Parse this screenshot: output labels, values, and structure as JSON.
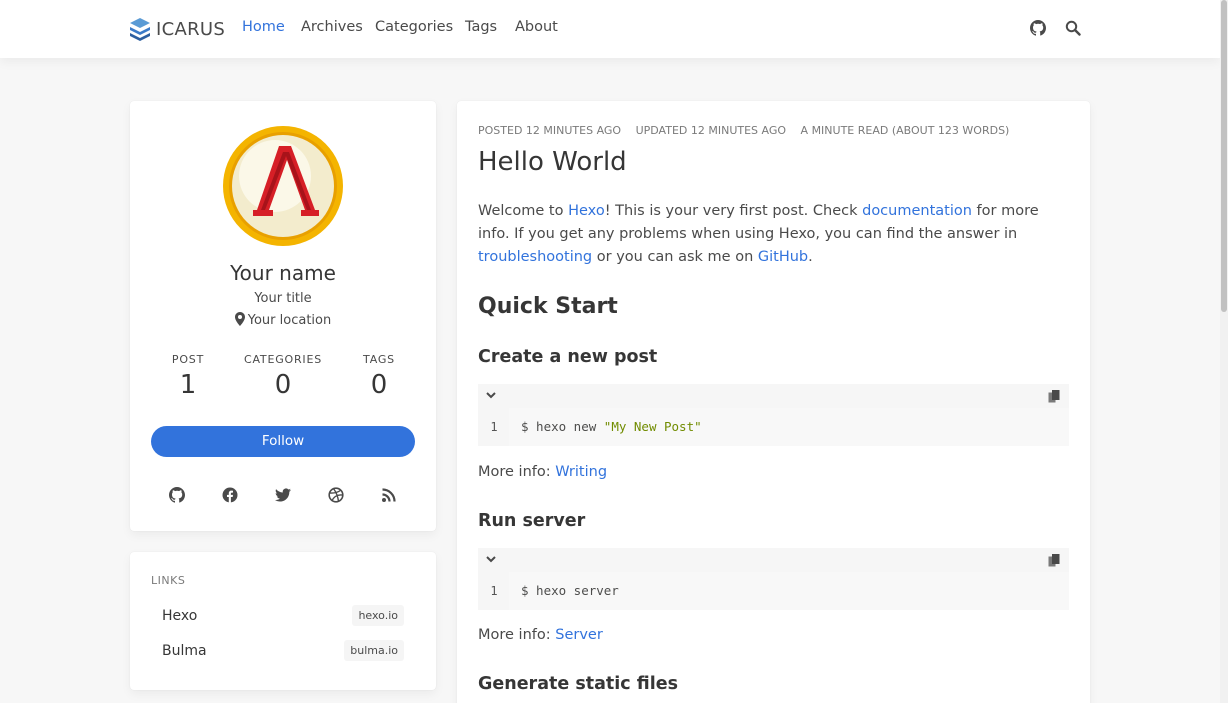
{
  "navbar": {
    "brand": "ICARUS",
    "items": [
      {
        "label": "Home",
        "active": true
      },
      {
        "label": "Archives",
        "active": false
      },
      {
        "label": "Categories",
        "active": false
      },
      {
        "label": "Tags",
        "active": false
      },
      {
        "label": "About",
        "active": false
      }
    ],
    "icons": [
      "github-icon",
      "search-icon"
    ]
  },
  "profile": {
    "name": "Your name",
    "title": "Your title",
    "location": "Your location",
    "stats": [
      {
        "label": "POST",
        "value": "1"
      },
      {
        "label": "CATEGORIES",
        "value": "0"
      },
      {
        "label": "TAGS",
        "value": "0"
      }
    ],
    "follow_label": "Follow",
    "social_icons": [
      "github-icon",
      "facebook-icon",
      "twitter-icon",
      "dribbble-icon",
      "rss-icon"
    ]
  },
  "links": {
    "heading": "LINKS",
    "items": [
      {
        "name": "Hexo",
        "url": "hexo.io"
      },
      {
        "name": "Bulma",
        "url": "bulma.io"
      }
    ]
  },
  "post": {
    "meta": {
      "posted": "POSTED 12 MINUTES AGO",
      "updated": "UPDATED 12 MINUTES AGO",
      "read": "A MINUTE READ (ABOUT 123 WORDS)"
    },
    "title": "Hello World",
    "intro": {
      "t1": "Welcome to ",
      "l1": "Hexo",
      "t2": "! This is your very first post. Check ",
      "l2": "documentation",
      "t3": " for more info. If you get any problems when using Hexo, you can find the answer in ",
      "l3": "troubleshooting",
      "t4": " or you can ask me on ",
      "l4": "GitHub",
      "t5": "."
    },
    "quick_start": "Quick Start",
    "sections": [
      {
        "heading": "Create a new post",
        "line_no": "1",
        "code_cmd": "$ hexo new ",
        "code_str": "\"My New Post\"",
        "more_label": "More info: ",
        "more_link": "Writing"
      },
      {
        "heading": "Run server",
        "line_no": "1",
        "code_cmd": "$ hexo server",
        "code_str": "",
        "more_label": "More info: ",
        "more_link": "Server"
      }
    ],
    "next_heading": "Generate static files"
  },
  "colors": {
    "accent": "#3273dc",
    "background": "#f7f7f7",
    "code_string": "#718c00"
  }
}
